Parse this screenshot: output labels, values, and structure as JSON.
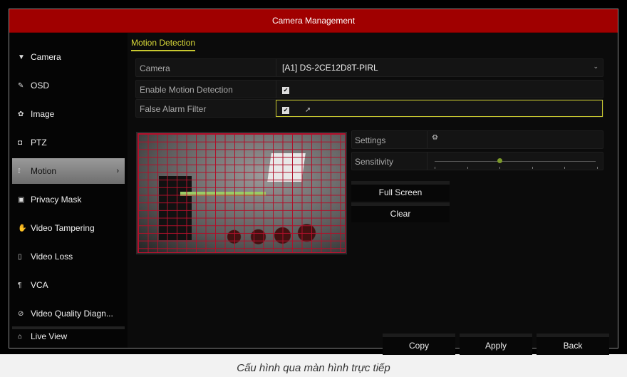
{
  "window": {
    "title": "Camera Management"
  },
  "sidebar": {
    "items": [
      {
        "label": "Camera",
        "icon": "camera-icon"
      },
      {
        "label": "OSD",
        "icon": "osd-icon"
      },
      {
        "label": "Image",
        "icon": "image-icon"
      },
      {
        "label": "PTZ",
        "icon": "ptz-icon"
      },
      {
        "label": "Motion",
        "icon": "motion-icon",
        "active": true
      },
      {
        "label": "Privacy Mask",
        "icon": "privacy-mask-icon"
      },
      {
        "label": "Video Tampering",
        "icon": "hand-icon"
      },
      {
        "label": "Video Loss",
        "icon": "video-loss-icon"
      },
      {
        "label": "VCA",
        "icon": "vca-icon"
      },
      {
        "label": "Video Quality Diagn...",
        "icon": "diagnostics-icon"
      }
    ],
    "live_view": "Live View"
  },
  "main": {
    "tab": "Motion Detection",
    "camera_label": "Camera",
    "camera_value": "[A1] DS-2CE12D8T-PIRL",
    "enable_label": "Enable Motion Detection",
    "enable_checked": true,
    "false_alarm_label": "False Alarm Filter",
    "false_alarm_checked": true,
    "settings_label": "Settings",
    "sensitivity_label": "Sensitivity",
    "sensitivity_level": 3,
    "sensitivity_max": 6,
    "full_screen": "Full Screen",
    "clear": "Clear"
  },
  "footer": {
    "copy": "Copy",
    "apply": "Apply",
    "back": "Back"
  },
  "caption": "Cấu hình qua màn hình trực tiếp",
  "colors": {
    "header": "#a00000",
    "accent": "#c8c830",
    "grid": "#b0102a"
  }
}
